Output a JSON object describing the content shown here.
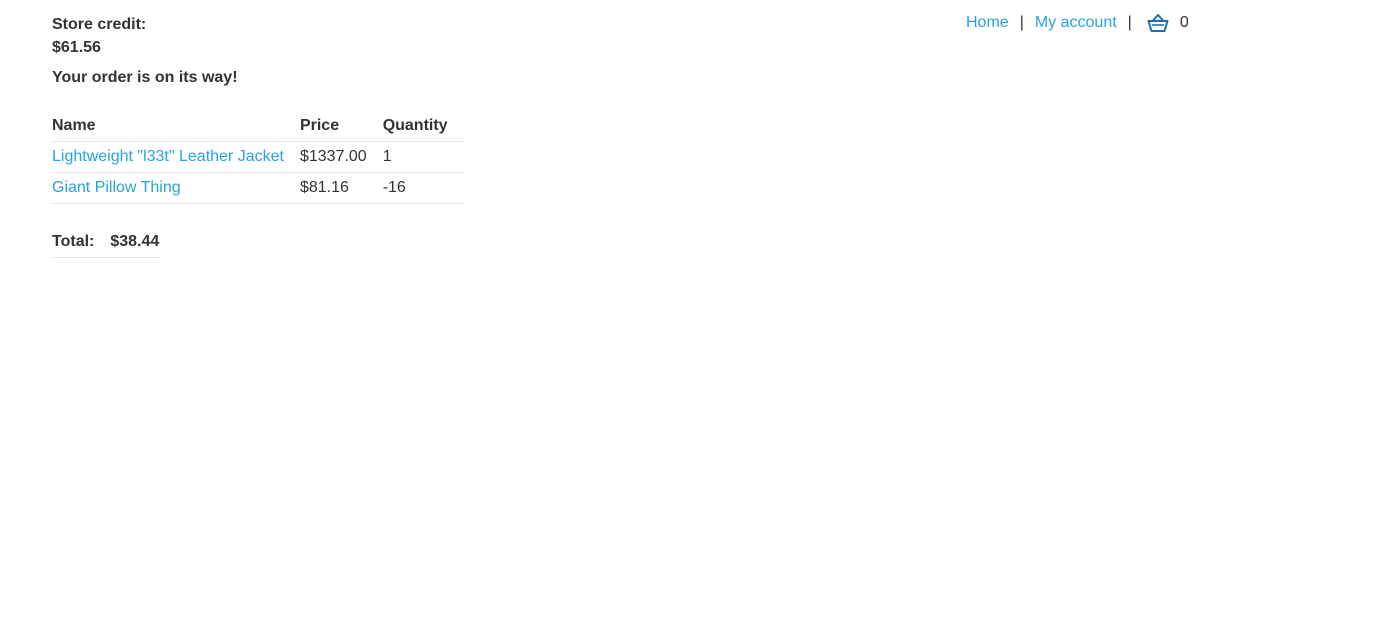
{
  "account": {
    "store_credit_label": "Store credit:",
    "store_credit_value": "$61.56"
  },
  "nav": {
    "home_label": "Home",
    "separator": "|",
    "my_account_label": "My account",
    "cart_icon": "basket-icon",
    "cart_count": "0"
  },
  "order": {
    "message": "Your order is on its way!",
    "columns": [
      "Name",
      "Price",
      "Quantity"
    ],
    "rows": [
      {
        "name": "Lightweight \"l33t\" Leather Jacket",
        "price": "$1337.00",
        "quantity": "1"
      },
      {
        "name": "Giant Pillow Thing",
        "price": "$81.16",
        "quantity": "-16"
      }
    ],
    "total_label": "Total:",
    "total_value": "$38.44"
  },
  "colors": {
    "link": "#29a3d9",
    "text": "#333332",
    "icon": "#1f6fb0",
    "rule": "#e6e6e6"
  }
}
